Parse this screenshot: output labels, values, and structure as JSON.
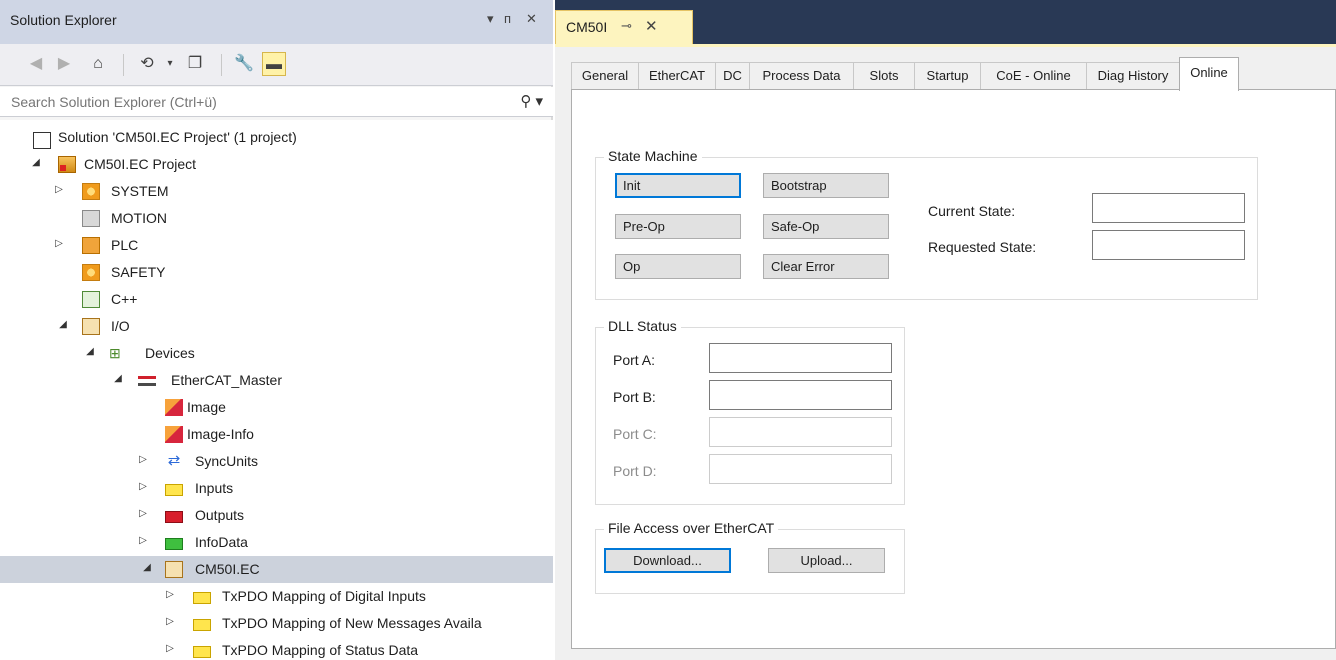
{
  "solution_explorer": {
    "title": "Solution Explorer",
    "title_buttons": [
      "▾",
      "ᴨ",
      "✕"
    ],
    "search_placeholder": "Search Solution Explorer (Ctrl+ü)",
    "tree": [
      {
        "label": "Solution 'CM50I.EC Project' (1 project)",
        "icon": "solution-icon",
        "arrow": ""
      },
      {
        "label": "CM50I.EC Project",
        "icon": "project-icon",
        "arrow": "◢"
      },
      {
        "label": "SYSTEM",
        "icon": "system-icon",
        "arrow": "▷"
      },
      {
        "label": "MOTION",
        "icon": "motion-icon",
        "arrow": ""
      },
      {
        "label": "PLC",
        "icon": "plc-icon",
        "arrow": "▷"
      },
      {
        "label": "SAFETY",
        "icon": "safety-icon",
        "arrow": ""
      },
      {
        "label": "C++",
        "icon": "cpp-icon",
        "arrow": ""
      },
      {
        "label": "I/O",
        "icon": "io-icon",
        "arrow": "◢"
      },
      {
        "label": "Devices",
        "icon": "devices-icon",
        "arrow": "◢"
      },
      {
        "label": "EtherCAT_Master",
        "icon": "ethercat-master-icon",
        "arrow": "◢"
      },
      {
        "label": "Image",
        "icon": "image-icon",
        "arrow": ""
      },
      {
        "label": "Image-Info",
        "icon": "image-info-icon",
        "arrow": ""
      },
      {
        "label": "SyncUnits",
        "icon": "syncunits-icon",
        "arrow": "▷"
      },
      {
        "label": "Inputs",
        "icon": "inputs-icon",
        "arrow": "▷"
      },
      {
        "label": "Outputs",
        "icon": "outputs-icon",
        "arrow": "▷"
      },
      {
        "label": "InfoData",
        "icon": "infodata-icon",
        "arrow": "▷"
      },
      {
        "label": "CM50I.EC",
        "icon": "device-icon",
        "arrow": "◢",
        "selected": true
      },
      {
        "label": "TxPDO Mapping of Digital Inputs",
        "icon": "folder-icon",
        "arrow": "▷"
      },
      {
        "label": "TxPDO Mapping of New Messages Availa",
        "icon": "folder-icon",
        "arrow": "▷"
      },
      {
        "label": "TxPDO Mapping of Status Data",
        "icon": "folder-icon",
        "arrow": "▷"
      }
    ]
  },
  "document_tab": {
    "name": "CM50I",
    "pin": "⊸",
    "close": "✕"
  },
  "property_tabs": [
    "General",
    "EtherCAT",
    "DC",
    "Process Data",
    "Slots",
    "Startup",
    "CoE - Online",
    "Diag History",
    "Online"
  ],
  "active_tab": "Online",
  "state_machine": {
    "title": "State Machine",
    "buttons": {
      "init": "Init",
      "bootstrap": "Bootstrap",
      "preop": "Pre-Op",
      "safeop": "Safe-Op",
      "op": "Op",
      "clear_error": "Clear Error"
    },
    "current_state_label": "Current State:",
    "requested_state_label": "Requested State:",
    "current_state_value": "",
    "requested_state_value": ""
  },
  "dll_status": {
    "title": "DLL Status",
    "ports": [
      {
        "label": "Port A:",
        "value": "",
        "enabled": true
      },
      {
        "label": "Port B:",
        "value": "",
        "enabled": true
      },
      {
        "label": "Port C:",
        "value": "",
        "enabled": false
      },
      {
        "label": "Port D:",
        "value": "",
        "enabled": false
      }
    ]
  },
  "file_access": {
    "title": "File Access over EtherCAT",
    "download": "Download...",
    "upload": "Upload..."
  }
}
